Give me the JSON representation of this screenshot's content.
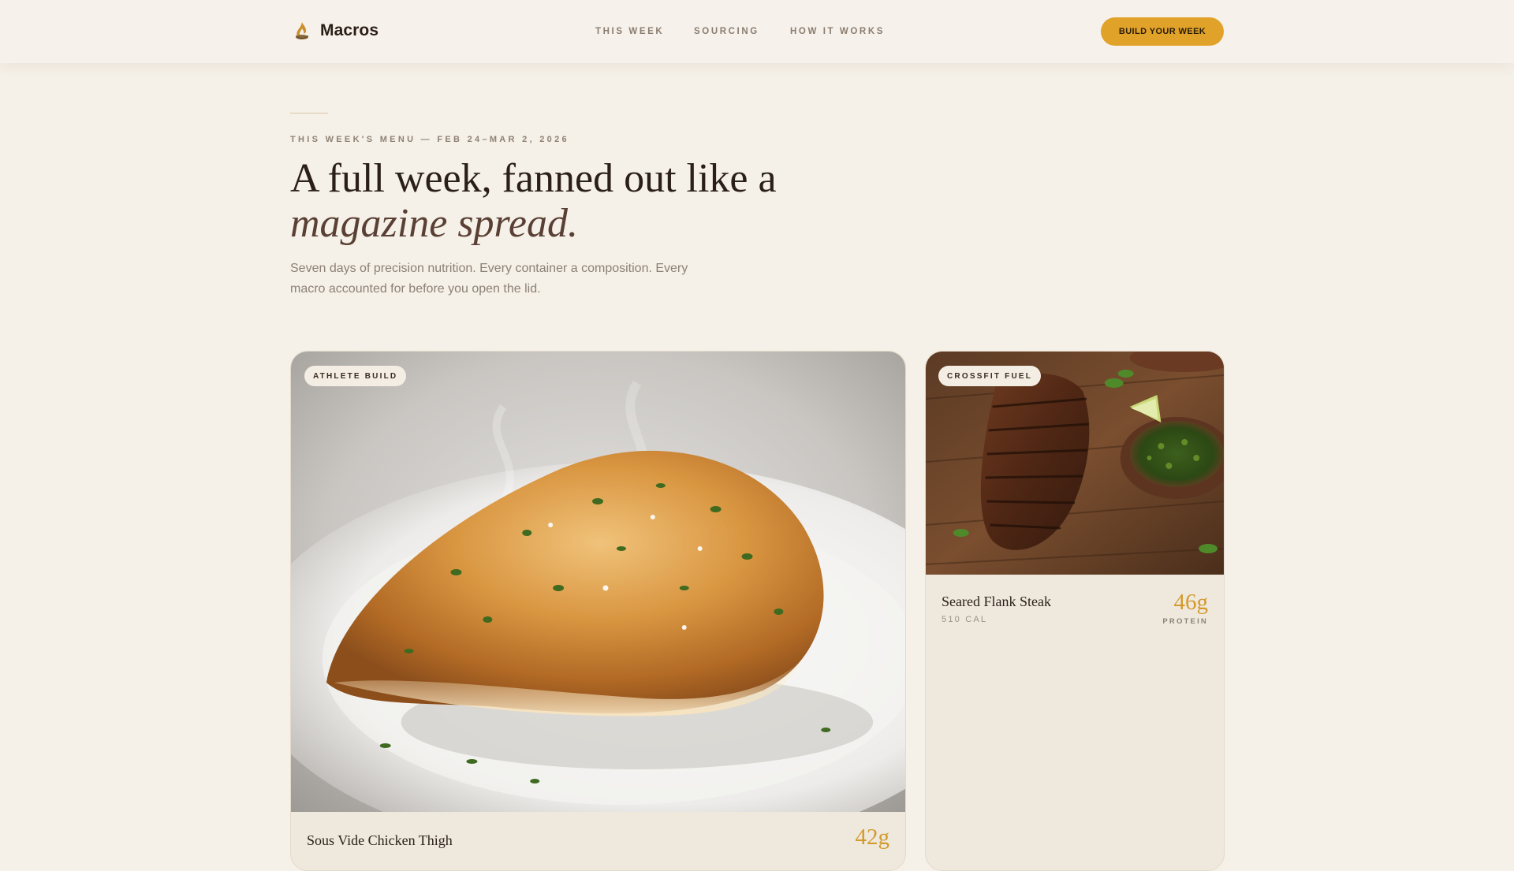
{
  "brand": {
    "name": "Macros",
    "icon": "flame-icon"
  },
  "nav": [
    {
      "label": "THIS WEEK"
    },
    {
      "label": "SOURCING"
    },
    {
      "label": "HOW IT WORKS"
    }
  ],
  "cta": {
    "label": "BUILD YOUR WEEK"
  },
  "hero": {
    "eyebrow": "THIS WEEK'S MENU — FEB 24–MAR 2, 2026",
    "headline_line1": "A full week, fanned out like a",
    "headline_line2": "magazine spread.",
    "subtitle": "Seven days of precision nutrition. Every container a composition. Every macro accounted for before you open the lid."
  },
  "meals": [
    {
      "tag": "ATHLETE BUILD",
      "name": "Sous Vide Chicken Thigh",
      "protein": "42g",
      "image": "seared-chicken-breast-photo"
    },
    {
      "tag": "CROSSFIT FUEL",
      "name": "Seared Flank Steak",
      "calories": "510 CAL",
      "protein": "46g",
      "protein_label": "PROTEIN",
      "image": "sliced-flank-steak-photo"
    }
  ],
  "colors": {
    "background": "#f5f0e8",
    "accent": "#e1a22a",
    "protein": "#d39a2c"
  }
}
